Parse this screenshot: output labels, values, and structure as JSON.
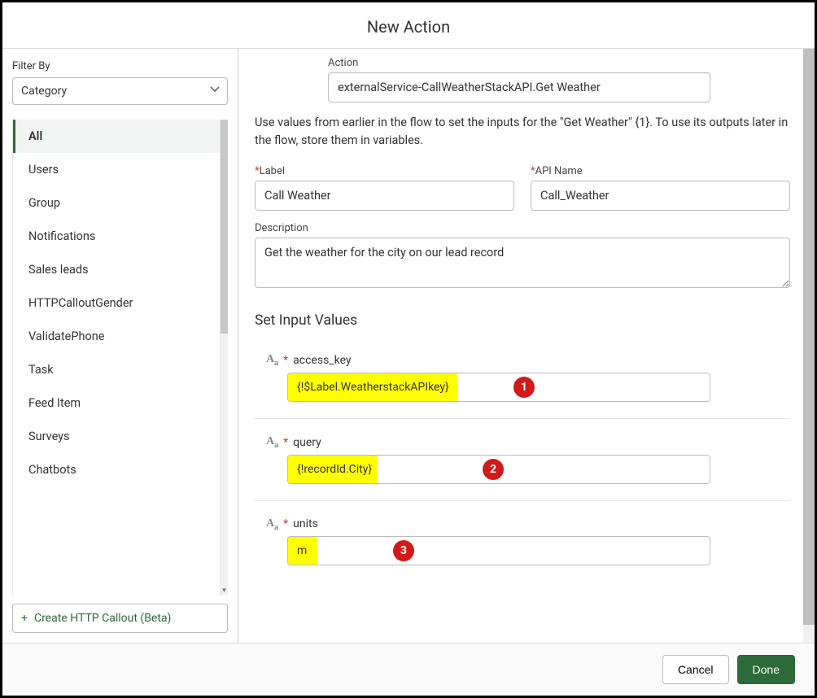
{
  "header": {
    "title": "New Action"
  },
  "sidebar": {
    "filter_label": "Filter By",
    "filter_value": "Category",
    "items": [
      {
        "label": "All",
        "selected": true
      },
      {
        "label": "Users",
        "selected": false
      },
      {
        "label": "Group",
        "selected": false
      },
      {
        "label": "Notifications",
        "selected": false
      },
      {
        "label": "Sales leads",
        "selected": false
      },
      {
        "label": "HTTPCalloutGender",
        "selected": false
      },
      {
        "label": "ValidatePhone",
        "selected": false
      },
      {
        "label": "Task",
        "selected": false
      },
      {
        "label": "Feed Item",
        "selected": false
      },
      {
        "label": "Surveys",
        "selected": false
      },
      {
        "label": "Chatbots",
        "selected": false
      }
    ],
    "create_callout_label": "Create HTTP Callout (Beta)"
  },
  "main": {
    "action_label": "Action",
    "action_value": "externalService-CallWeatherStackAPI.Get Weather",
    "help_text": "Use values from earlier in the flow to set the inputs for the \"Get Weather\" {1}. To use its outputs later in the flow, store them in variables.",
    "label_label": "Label",
    "label_value": "Call Weather",
    "apiname_label": "API Name",
    "apiname_value": "Call_Weather",
    "description_label": "Description",
    "description_value": "Get the weather for the city on our lead record",
    "section_heading": "Set Input Values",
    "inputs": [
      {
        "name": "access_key",
        "value": "{!$Label.WeatherstackAPIkey}",
        "marker": "1",
        "hw": 208,
        "mk": 278
      },
      {
        "name": "query",
        "value": "{!recordId.City}",
        "marker": "2",
        "hw": 110,
        "mk": 240
      },
      {
        "name": "units",
        "value": "m",
        "marker": "3",
        "hw": 36,
        "mk": 130
      }
    ]
  },
  "footer": {
    "cancel": "Cancel",
    "done": "Done"
  }
}
